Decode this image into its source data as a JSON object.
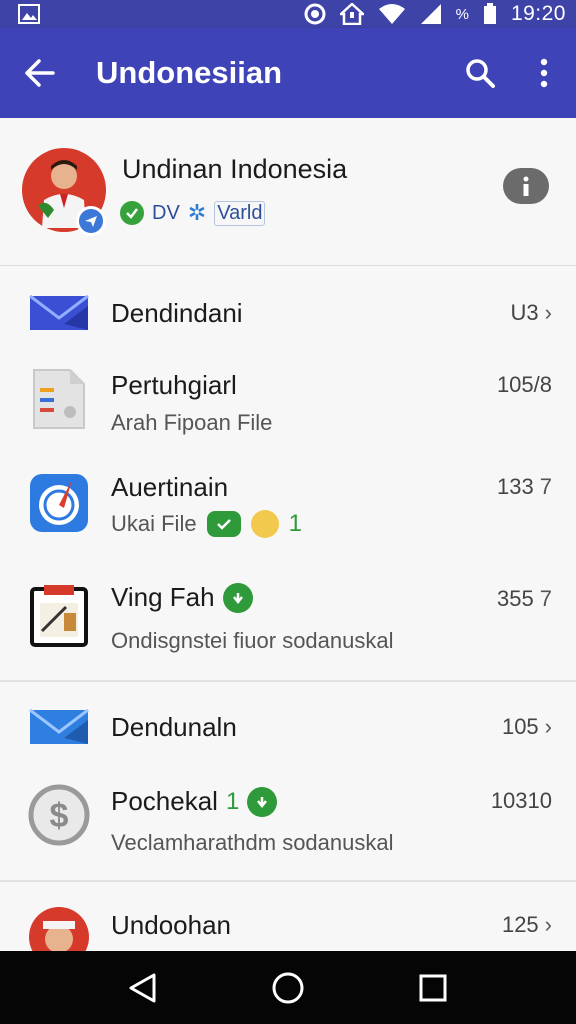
{
  "status_bar": {
    "time": "19:20",
    "battery_percent_label": "%"
  },
  "app_bar": {
    "title": "Undonesiian"
  },
  "profile": {
    "name": "Undinan Indonesia",
    "sub_prefix": "DV",
    "sub_tag": "Varld"
  },
  "rows": [
    {
      "title": "Dendindani",
      "subtitle": "",
      "meta": "U3",
      "chevron": "›"
    },
    {
      "title": "Pertuhgiarl",
      "subtitle": "Arah Fipoan File",
      "meta": "105/8",
      "chevron": ""
    },
    {
      "title": "Auertinain",
      "subtitle": "Ukai File",
      "sub_count": "1",
      "meta": "133",
      "chevron": "7"
    },
    {
      "title": "Ving Fah",
      "subtitle": "Ondisgnstei fiuor sodanuskal",
      "meta": "355",
      "chevron": "7"
    },
    {
      "title": "Dendunaln",
      "subtitle": "",
      "meta": "105",
      "chevron": "›"
    },
    {
      "title": "Pochekal",
      "title_count": "1",
      "subtitle": "Veclamharathdm sodanuskal",
      "meta": "10310",
      "chevron": ""
    },
    {
      "title": "Undoohan",
      "subtitle": "",
      "meta": "125",
      "chevron": "›"
    }
  ],
  "colors": {
    "app_bar": "#3e43b7",
    "status_bar": "#3e43a8",
    "accent_green": "#2f9a3a",
    "mail_blue": "#2f6fd6"
  },
  "icons": {
    "status": [
      "image-icon",
      "location-ring-icon",
      "home-alert-icon",
      "wifi-icon",
      "signal-icon",
      "battery-icon"
    ],
    "app_bar": [
      "back-arrow-icon",
      "search-icon",
      "more-vert-icon"
    ],
    "nav": [
      "back-triangle-icon",
      "home-circle-icon",
      "recents-square-icon"
    ]
  }
}
